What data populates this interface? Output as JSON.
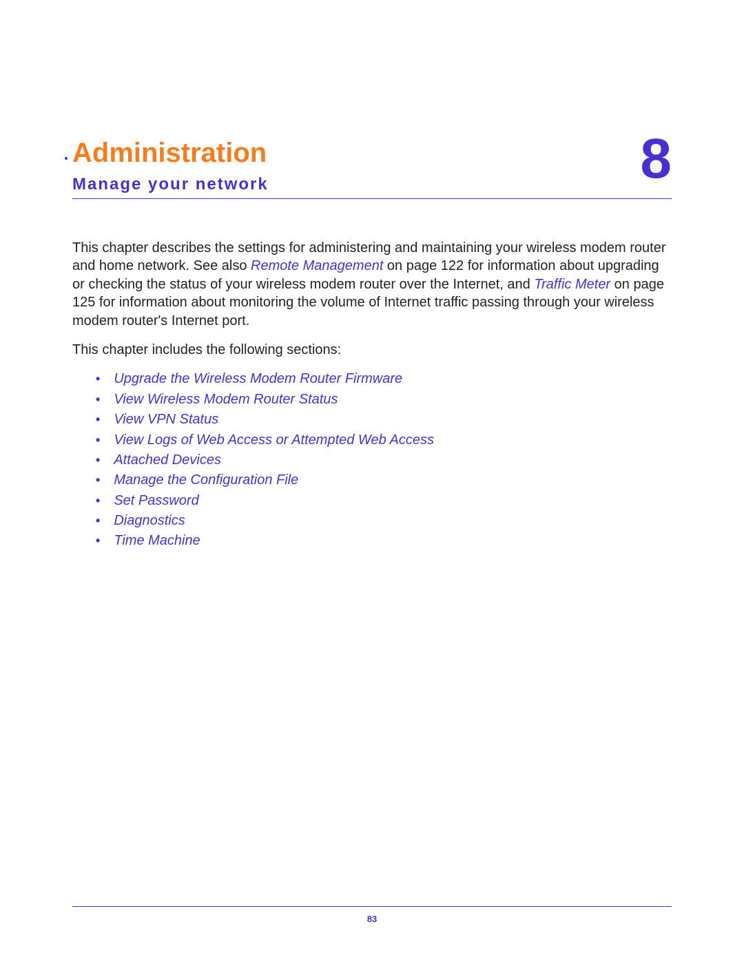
{
  "chapter": {
    "title": "Administration",
    "subtitle": "Manage your network",
    "number": "8"
  },
  "intro": {
    "part1": "This chapter describes the settings for administering and maintaining your wireless modem router and home network. See also ",
    "link1": "Remote Management",
    "part2": " on page 122 for information about upgrading or checking the status of your wireless modem router over the Internet, and ",
    "link2": "Traffic Meter",
    "part3": " on page 125 for information about monitoring the volume of Internet traffic passing through your wireless modem router's Internet port."
  },
  "sections_intro": "This chapter includes the following sections:",
  "sections": [
    "Upgrade the Wireless Modem Router Firmware",
    "View Wireless Modem Router Status",
    "View VPN Status",
    "View Logs of Web Access or Attempted Web Access",
    "Attached Devices",
    "Manage the Configuration File",
    "Set Password",
    "Diagnostics",
    "Time Machine"
  ],
  "page_number": "83"
}
